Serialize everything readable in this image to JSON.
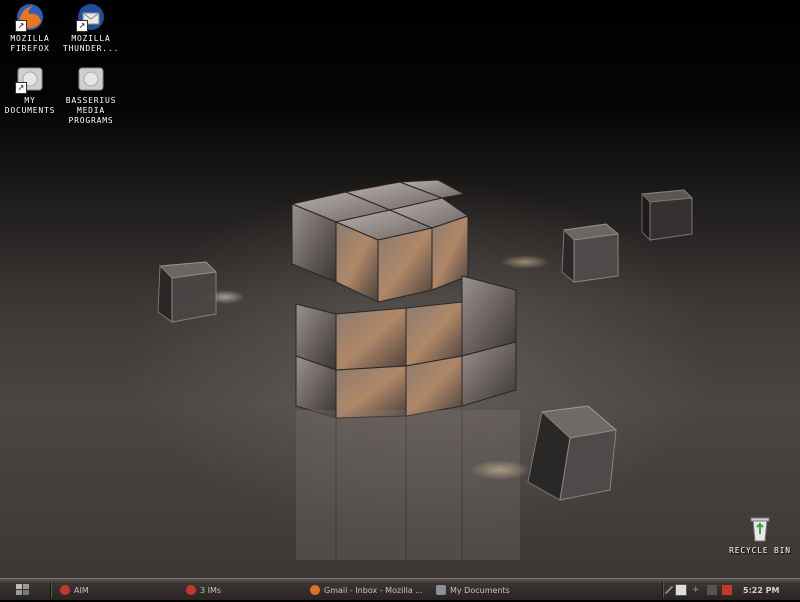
{
  "desktop": {
    "icons": [
      {
        "label_line1": "Mozilla",
        "label_line2": "Firefox",
        "icon": "firefox-icon"
      },
      {
        "label_line1": "Mozilla",
        "label_line2": "Thunder...",
        "icon": "thunderbird-icon"
      },
      {
        "label_line1": "My",
        "label_line2": "Documents",
        "icon": "folder-icon"
      },
      {
        "label_line1": "Basserius",
        "label_line2": "Media",
        "label_line3": "Programs",
        "icon": "folder-icon"
      },
      {
        "label_line1": "Recycle Bin",
        "icon": "recycle-bin-icon"
      }
    ]
  },
  "taskbar": {
    "start_icon": "windows-logo-icon",
    "buttons": [
      {
        "label": "AIM",
        "icon": "aim-icon",
        "color": "#c0392b"
      },
      {
        "label": "3 IMs",
        "icon": "aim-icon",
        "color": "#c0392b"
      },
      {
        "label": "Gmail - Inbox - Mozilla ...",
        "icon": "firefox-icon",
        "color": "#e07020"
      },
      {
        "label": "My Documents",
        "icon": "folder-icon",
        "color": "#8a8f98"
      }
    ],
    "clock": "5:22 PM"
  },
  "colors": {
    "taskbar_bg": "#2a2422",
    "taskbar_text": "#c9c0bb",
    "label_text": "#ffffff"
  }
}
